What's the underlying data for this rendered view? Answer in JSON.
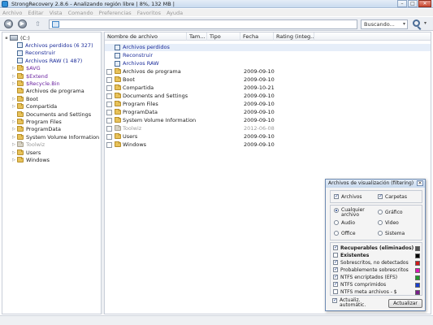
{
  "window": {
    "title": "StrongRecovery 2.8.6 - Analizando región libre | 8%, 132 MB |",
    "controls": {
      "minimize": "–",
      "maximize": "□",
      "close": "✕"
    }
  },
  "menu": [
    "Archivo",
    "Editar",
    "Vista",
    "Comando",
    "Preferencias",
    "Favoritos",
    "Ayuda"
  ],
  "toolbar": {
    "back": "◀",
    "forward": "▶",
    "up": "⇧",
    "address_value": "",
    "search_text": "Buscando...",
    "dropdown": "▾"
  },
  "tree": [
    {
      "label": "(C:)",
      "icon": "drive-icon",
      "color": "normal",
      "expander": "▪"
    },
    {
      "label": "Archivos perdidos (6 327)",
      "icon": "virtual-folder-icon",
      "color": "blue",
      "expander": ""
    },
    {
      "label": "Reconstruir",
      "icon": "virtual-folder-icon",
      "color": "blue",
      "expander": ""
    },
    {
      "label": "Archivos RAW (1 487)",
      "icon": "virtual-folder-icon",
      "color": "blue",
      "expander": ""
    },
    {
      "label": "$AVG",
      "icon": "folder-icon",
      "color": "purple",
      "expander": "▷"
    },
    {
      "label": "$Extend",
      "icon": "folder-icon",
      "color": "purple",
      "expander": "▷"
    },
    {
      "label": "$Recycle.Bin",
      "icon": "folder-icon",
      "color": "purple",
      "expander": "▷"
    },
    {
      "label": "Archivos de programa",
      "icon": "folder-icon",
      "color": "normal",
      "expander": ""
    },
    {
      "label": "Boot",
      "icon": "folder-icon",
      "color": "normal",
      "expander": "▷"
    },
    {
      "label": "Compartida",
      "icon": "folder-icon",
      "color": "normal",
      "expander": "▷"
    },
    {
      "label": "Documents and Settings",
      "icon": "folder-icon",
      "color": "normal",
      "expander": ""
    },
    {
      "label": "Program Files",
      "icon": "folder-icon",
      "color": "normal",
      "expander": "▷"
    },
    {
      "label": "ProgramData",
      "icon": "folder-icon",
      "color": "normal",
      "expander": "▷"
    },
    {
      "label": "System Volume Information",
      "icon": "folder-icon",
      "color": "normal",
      "expander": "▷"
    },
    {
      "label": "Toolwiz",
      "icon": "folder-icon",
      "color": "gray",
      "expander": "▷"
    },
    {
      "label": "Users",
      "icon": "folder-icon",
      "color": "normal",
      "expander": "▷"
    },
    {
      "label": "Windows",
      "icon": "folder-icon",
      "color": "normal",
      "expander": "▷"
    }
  ],
  "columns": [
    "Nombre de archivo",
    "Tam...",
    "Tipo",
    "Fecha",
    "Rating (integ..."
  ],
  "files": [
    {
      "name": "Archivos perdidos",
      "date": "",
      "kind": "virtual",
      "color": "blue",
      "checkbox": false,
      "selected": true
    },
    {
      "name": "Reconstruir",
      "date": "",
      "kind": "virtual",
      "color": "blue",
      "checkbox": false,
      "selected": false
    },
    {
      "name": "Archivos RAW",
      "date": "",
      "kind": "virtual",
      "color": "blue",
      "checkbox": false,
      "selected": false
    },
    {
      "name": "Archivos de programa",
      "date": "2009-09-10",
      "kind": "folder",
      "color": "normal",
      "checkbox": true,
      "selected": false
    },
    {
      "name": "Boot",
      "date": "2009-09-10",
      "kind": "folder",
      "color": "normal",
      "checkbox": true,
      "selected": false
    },
    {
      "name": "Compartida",
      "date": "2009-10-21",
      "kind": "folder",
      "color": "normal",
      "checkbox": true,
      "selected": false
    },
    {
      "name": "Documents and Settings",
      "date": "2009-09-10",
      "kind": "folder",
      "color": "normal",
      "checkbox": true,
      "selected": false
    },
    {
      "name": "Program Files",
      "date": "2009-09-10",
      "kind": "folder",
      "color": "normal",
      "checkbox": true,
      "selected": false
    },
    {
      "name": "ProgramData",
      "date": "2009-09-10",
      "kind": "folder",
      "color": "normal",
      "checkbox": true,
      "selected": false
    },
    {
      "name": "System Volume Information",
      "date": "2009-09-10",
      "kind": "folder",
      "color": "normal",
      "checkbox": true,
      "selected": false
    },
    {
      "name": "Toolwiz",
      "date": "2012-06-08",
      "kind": "folder",
      "color": "gray",
      "checkbox": true,
      "selected": false
    },
    {
      "name": "Users",
      "date": "2009-09-10",
      "kind": "folder",
      "color": "normal",
      "checkbox": true,
      "selected": false
    },
    {
      "name": "Windows",
      "date": "2009-09-10",
      "kind": "folder",
      "color": "normal",
      "checkbox": true,
      "selected": false
    }
  ],
  "filter": {
    "title": "Archivos de visualización (filtering)",
    "close": "✕",
    "files_label": "Archivos",
    "files_checked": true,
    "folders_label": "Carpetas",
    "folders_checked": true,
    "types": [
      {
        "label": "Cualquier archivo",
        "checked": true
      },
      {
        "label": "Gráfico",
        "checked": false
      },
      {
        "label": "Audio",
        "checked": false
      },
      {
        "label": "Video",
        "checked": false
      },
      {
        "label": "Office",
        "checked": false
      },
      {
        "label": "Sistema",
        "checked": false
      }
    ],
    "states": [
      {
        "label": "Recuperables (eliminados)",
        "checked": true,
        "bold": true,
        "color": "#555555"
      },
      {
        "label": "Existentes",
        "checked": false,
        "bold": true,
        "color": "#000000"
      },
      {
        "label": "Sobrescritos, no detectados",
        "checked": true,
        "bold": false,
        "color": "#d11a1a"
      },
      {
        "label": "Probablemente sobrescritos",
        "checked": true,
        "bold": false,
        "color": "#e013b8"
      },
      {
        "label": "NTFS encriptados (EFS)",
        "checked": true,
        "bold": false,
        "color": "#1d9a2a"
      },
      {
        "label": "NTFS comprimidos",
        "checked": true,
        "bold": false,
        "color": "#1a3fd1"
      },
      {
        "label": "NTFS meta archivos - $",
        "checked": false,
        "bold": false,
        "color": "#7a1f8c"
      }
    ],
    "auto_label": "Actualiz. automátic.",
    "auto_checked": true,
    "update_button": "Actualizar"
  }
}
